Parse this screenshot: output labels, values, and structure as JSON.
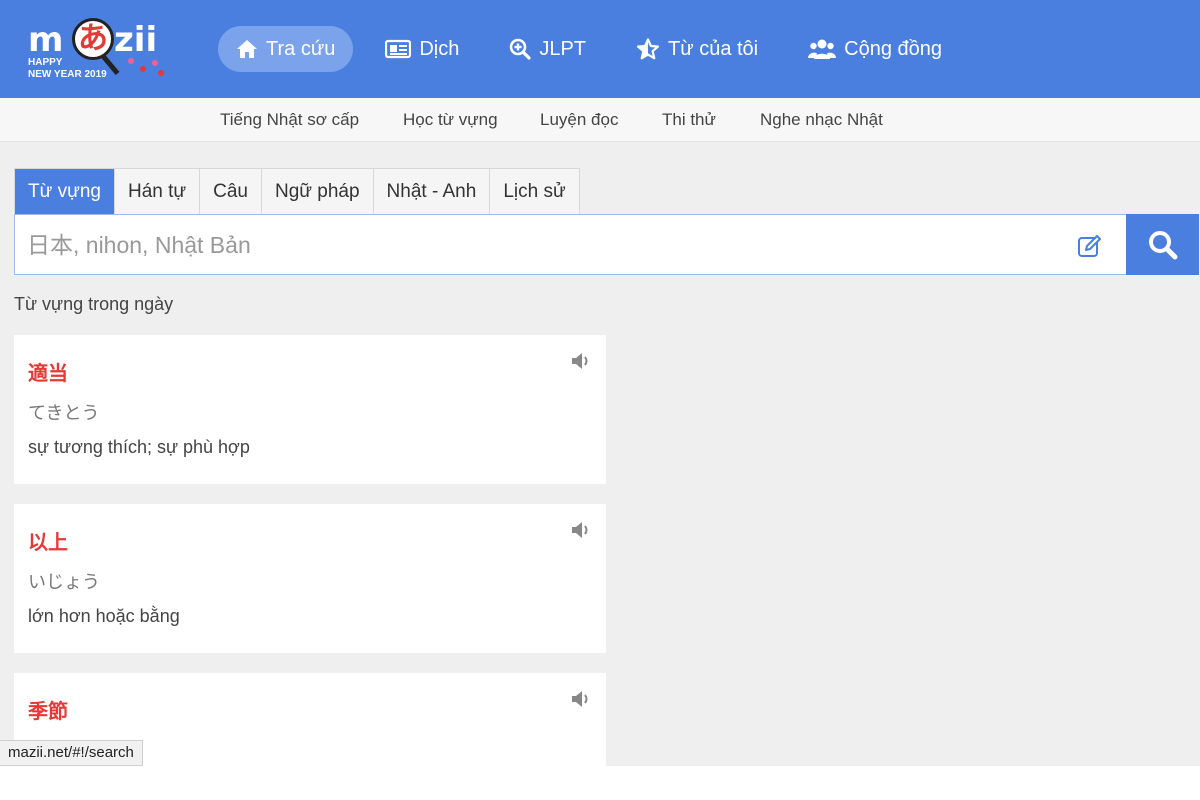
{
  "logo": {
    "brand_left": "m",
    "brand_kana": "あ",
    "brand_right": "zii",
    "tagline_line1": "HAPPY",
    "tagline_line2": "NEW YEAR 2019"
  },
  "nav": {
    "items": [
      {
        "label": "Tra cứu",
        "icon": "home-icon",
        "active": true
      },
      {
        "label": "Dịch",
        "icon": "newspaper-icon",
        "active": false
      },
      {
        "label": "JLPT",
        "icon": "zoom-in-icon",
        "active": false
      },
      {
        "label": "Từ của tôi",
        "icon": "star-icon",
        "active": false
      },
      {
        "label": "Cộng đồng",
        "icon": "users-icon",
        "active": false
      }
    ]
  },
  "subnav": {
    "items": [
      "Tiếng Nhật sơ cấp",
      "Học từ vựng",
      "Luyện đọc",
      "Thi thử",
      "Nghe nhạc Nhật"
    ]
  },
  "search": {
    "tabs": [
      "Từ vựng",
      "Hán tự",
      "Câu",
      "Ngữ pháp",
      "Nhật - Anh",
      "Lịch sử"
    ],
    "active_tab": "Từ vựng",
    "placeholder": "日本, nihon, Nhật Bản",
    "value": ""
  },
  "daily": {
    "title": "Từ vựng trong ngày",
    "cards": [
      {
        "kanji": "適当",
        "reading": "てきとう",
        "meaning": "sự tương thích; sự phù hợp"
      },
      {
        "kanji": "以上",
        "reading": "いじょう",
        "meaning": "lớn hơn hoặc bằng"
      },
      {
        "kanji": "季節",
        "reading": "",
        "meaning": ""
      }
    ]
  },
  "status": {
    "url": "mazii.net/#!/search"
  },
  "colors": {
    "primary": "#4a7fe0",
    "kanji": "#e53935",
    "background": "#efefef"
  }
}
